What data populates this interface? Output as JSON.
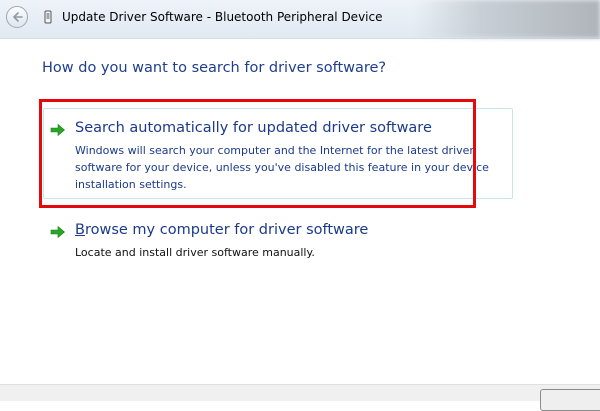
{
  "window": {
    "title": "Update Driver Software - Bluetooth Peripheral Device"
  },
  "heading": "How do you want to search for driver software?",
  "options": [
    {
      "title": "Search automatically for updated driver software",
      "description": "Windows will search your computer and the Internet for the latest driver software for your device, unless you've disabled this feature in your device installation settings."
    },
    {
      "title_accel": "B",
      "title_rest": "rowse my computer for driver software",
      "description": "Locate and install driver software manually."
    }
  ],
  "colors": {
    "heading": "#1f3e8c",
    "option_text": "#1b3a8a",
    "highlight": "#e20a0a",
    "arrow": "#2aa52a"
  },
  "icons": {
    "back": "back-arrow-icon",
    "device": "device-icon",
    "option_arrow": "green-arrow-icon"
  }
}
